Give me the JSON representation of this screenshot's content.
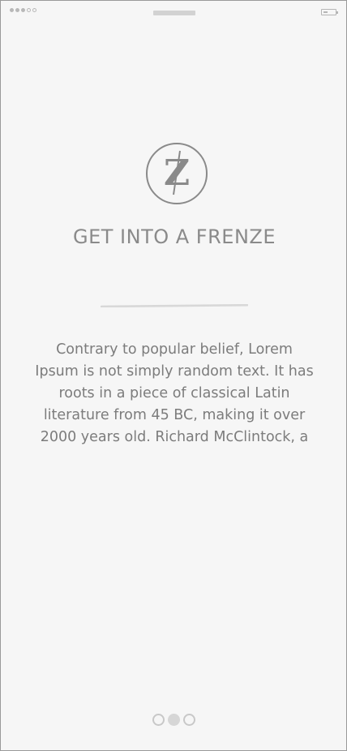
{
  "status_bar": {
    "signal_icon": "signal-dots-icon",
    "signal_bars_filled": 3,
    "signal_bars_total": 5,
    "notch_icon": "notch",
    "battery_icon": "battery-icon"
  },
  "logo": {
    "letter": "Z",
    "icon": "circle-z-logo"
  },
  "title": "GET INTO A FRENZE",
  "description": "Contrary to popular belief, Lorem Ipsum is not simply random text. It has roots in a piece of classical Latin literature from 45 BC, making it over 2000 years old. Richard McClintock, a",
  "pager": {
    "total": 3,
    "active_index": 1
  },
  "colors": {
    "background": "#f6f6f6",
    "frame_border": "#9a9a9a",
    "title": "#8a8a8a",
    "body_text": "#7c7c7c",
    "logo": "#8a8a8a",
    "divider": "#d8d8d8",
    "pager_inactive": "#c8c8c8",
    "pager_active": "#d6d6d6"
  }
}
